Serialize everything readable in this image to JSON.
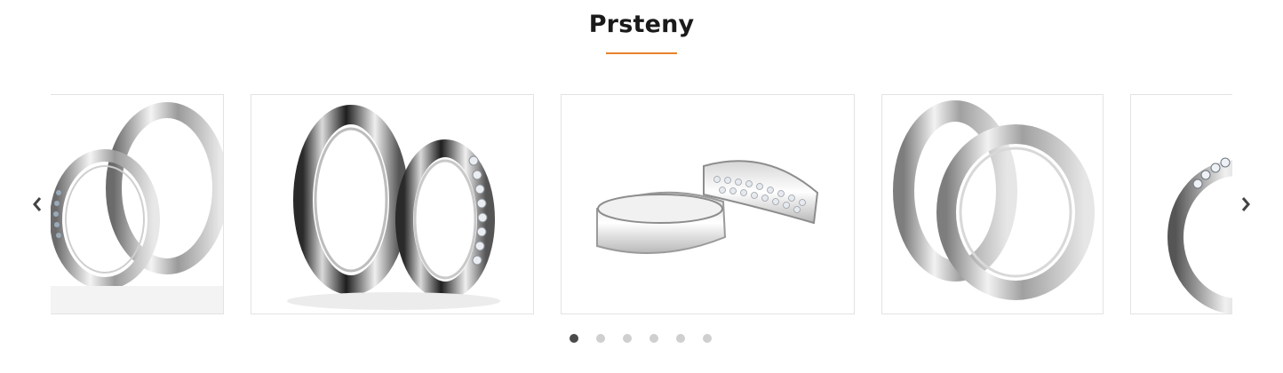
{
  "section": {
    "title": "Prsteny"
  },
  "colors": {
    "accent": "#e8822c",
    "dot_active": "#4a4a4a",
    "dot_inactive": "#cfcfcf",
    "arrow": "#444444"
  },
  "carousel": {
    "prev_icon": "chevron-left-icon",
    "next_icon": "chevron-right-icon",
    "slides": [
      {
        "image": "ring-pair-engraved-image"
      },
      {
        "image": "ring-pair-black-diamond-image"
      },
      {
        "image": "ring-pair-diamond-band-image"
      },
      {
        "image": "ring-pair-bevel-image"
      },
      {
        "image": "ring-diamond-partial-image"
      }
    ],
    "dots": [
      {
        "active": true
      },
      {
        "active": false
      },
      {
        "active": false
      },
      {
        "active": false
      },
      {
        "active": false
      },
      {
        "active": false
      }
    ]
  }
}
